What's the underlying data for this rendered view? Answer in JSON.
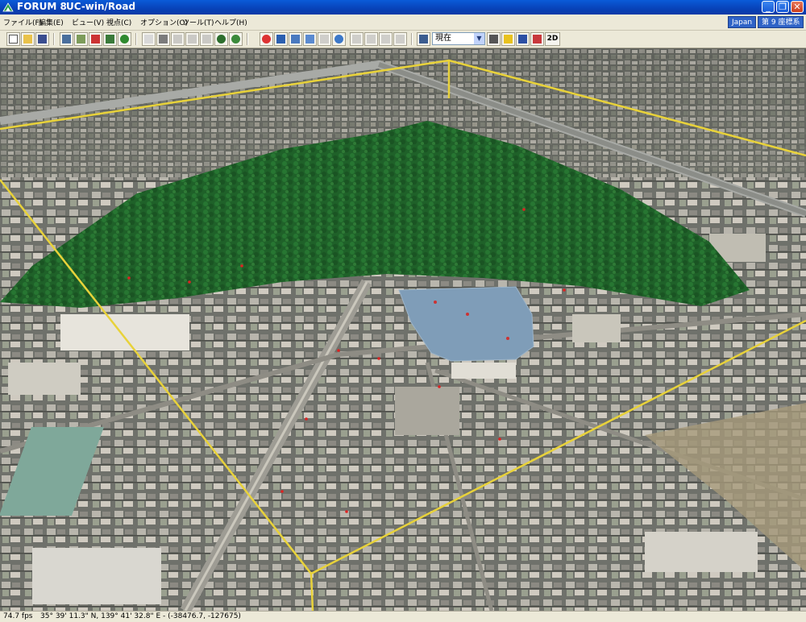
{
  "window": {
    "app_name": "FORUM 8",
    "title": "UC-win/Road",
    "minimize_icon": "minimize-icon",
    "maximize_icon": "restore-icon",
    "close_icon": "close-icon"
  },
  "menu": {
    "items": [
      {
        "label": "ファイル(F)"
      },
      {
        "label": "編集(E)"
      },
      {
        "label": "ビュー(V)"
      },
      {
        "label": "視点(C)"
      },
      {
        "label": "オプション(O)"
      },
      {
        "label": "ツール(T)"
      },
      {
        "label": "ヘルプ(H)"
      }
    ],
    "region_badge": "Japan",
    "coordinate_badge": "第 9 座標系"
  },
  "toolbar": {
    "view_select_value": "現在",
    "twod_label": "2D"
  },
  "status": {
    "fps": "74.7 fps",
    "coords": "35°  39' 11.3\" N, 139°  41' 32.8\" E  -  (-38476.7, -127675)"
  },
  "colors": {
    "titlebar": "#0a4fc4",
    "selection_outline": "#e8d23a",
    "park": "#1f6b2b",
    "pond": "#7f9db8"
  }
}
